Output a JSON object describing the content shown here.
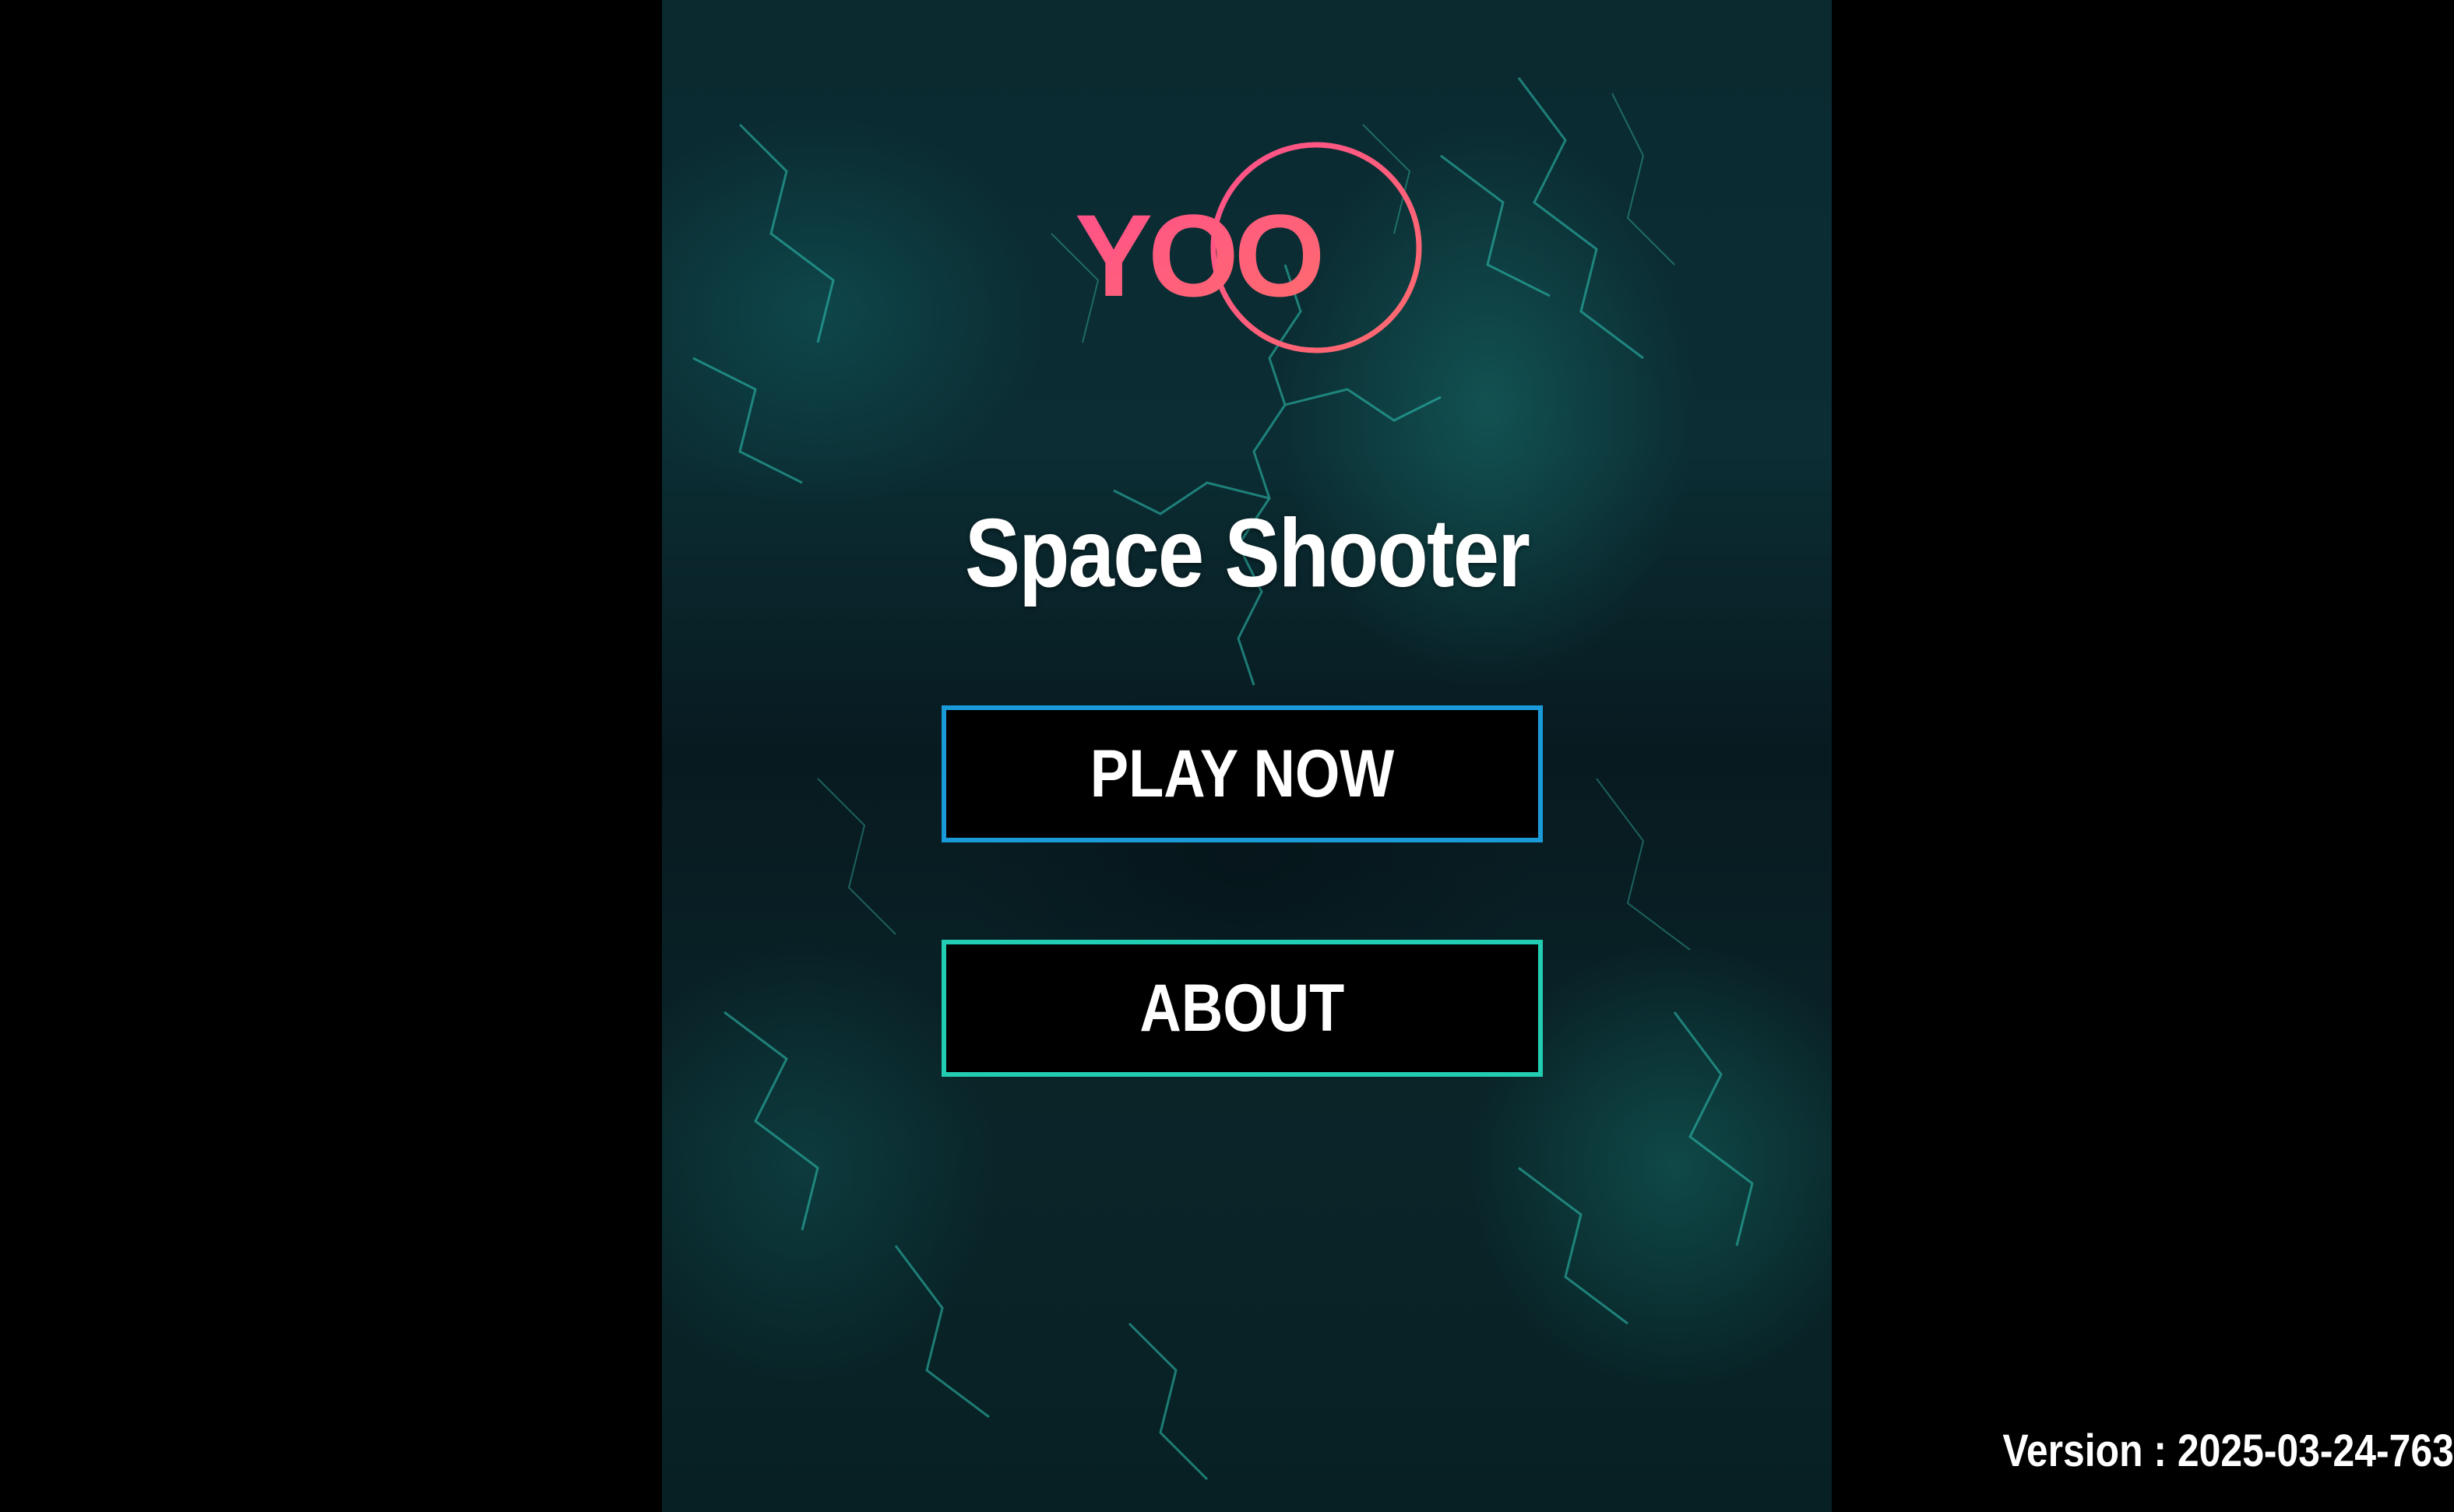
{
  "logo": {
    "text": "YOO",
    "icon": "yoo-logo-ring",
    "gradient_start": "#ff4f8b",
    "gradient_end": "#ff6d6d"
  },
  "title": "Space Shooter",
  "menu": {
    "play_label": "PLAY NOW",
    "about_label": "ABOUT",
    "play_border_color": "#1a9ad8",
    "about_border_color": "#23cdb2"
  },
  "version": "Version : 2025-03-24-763",
  "background": {
    "outer_color": "#000000",
    "nebula_color": "#1fb5a5"
  }
}
